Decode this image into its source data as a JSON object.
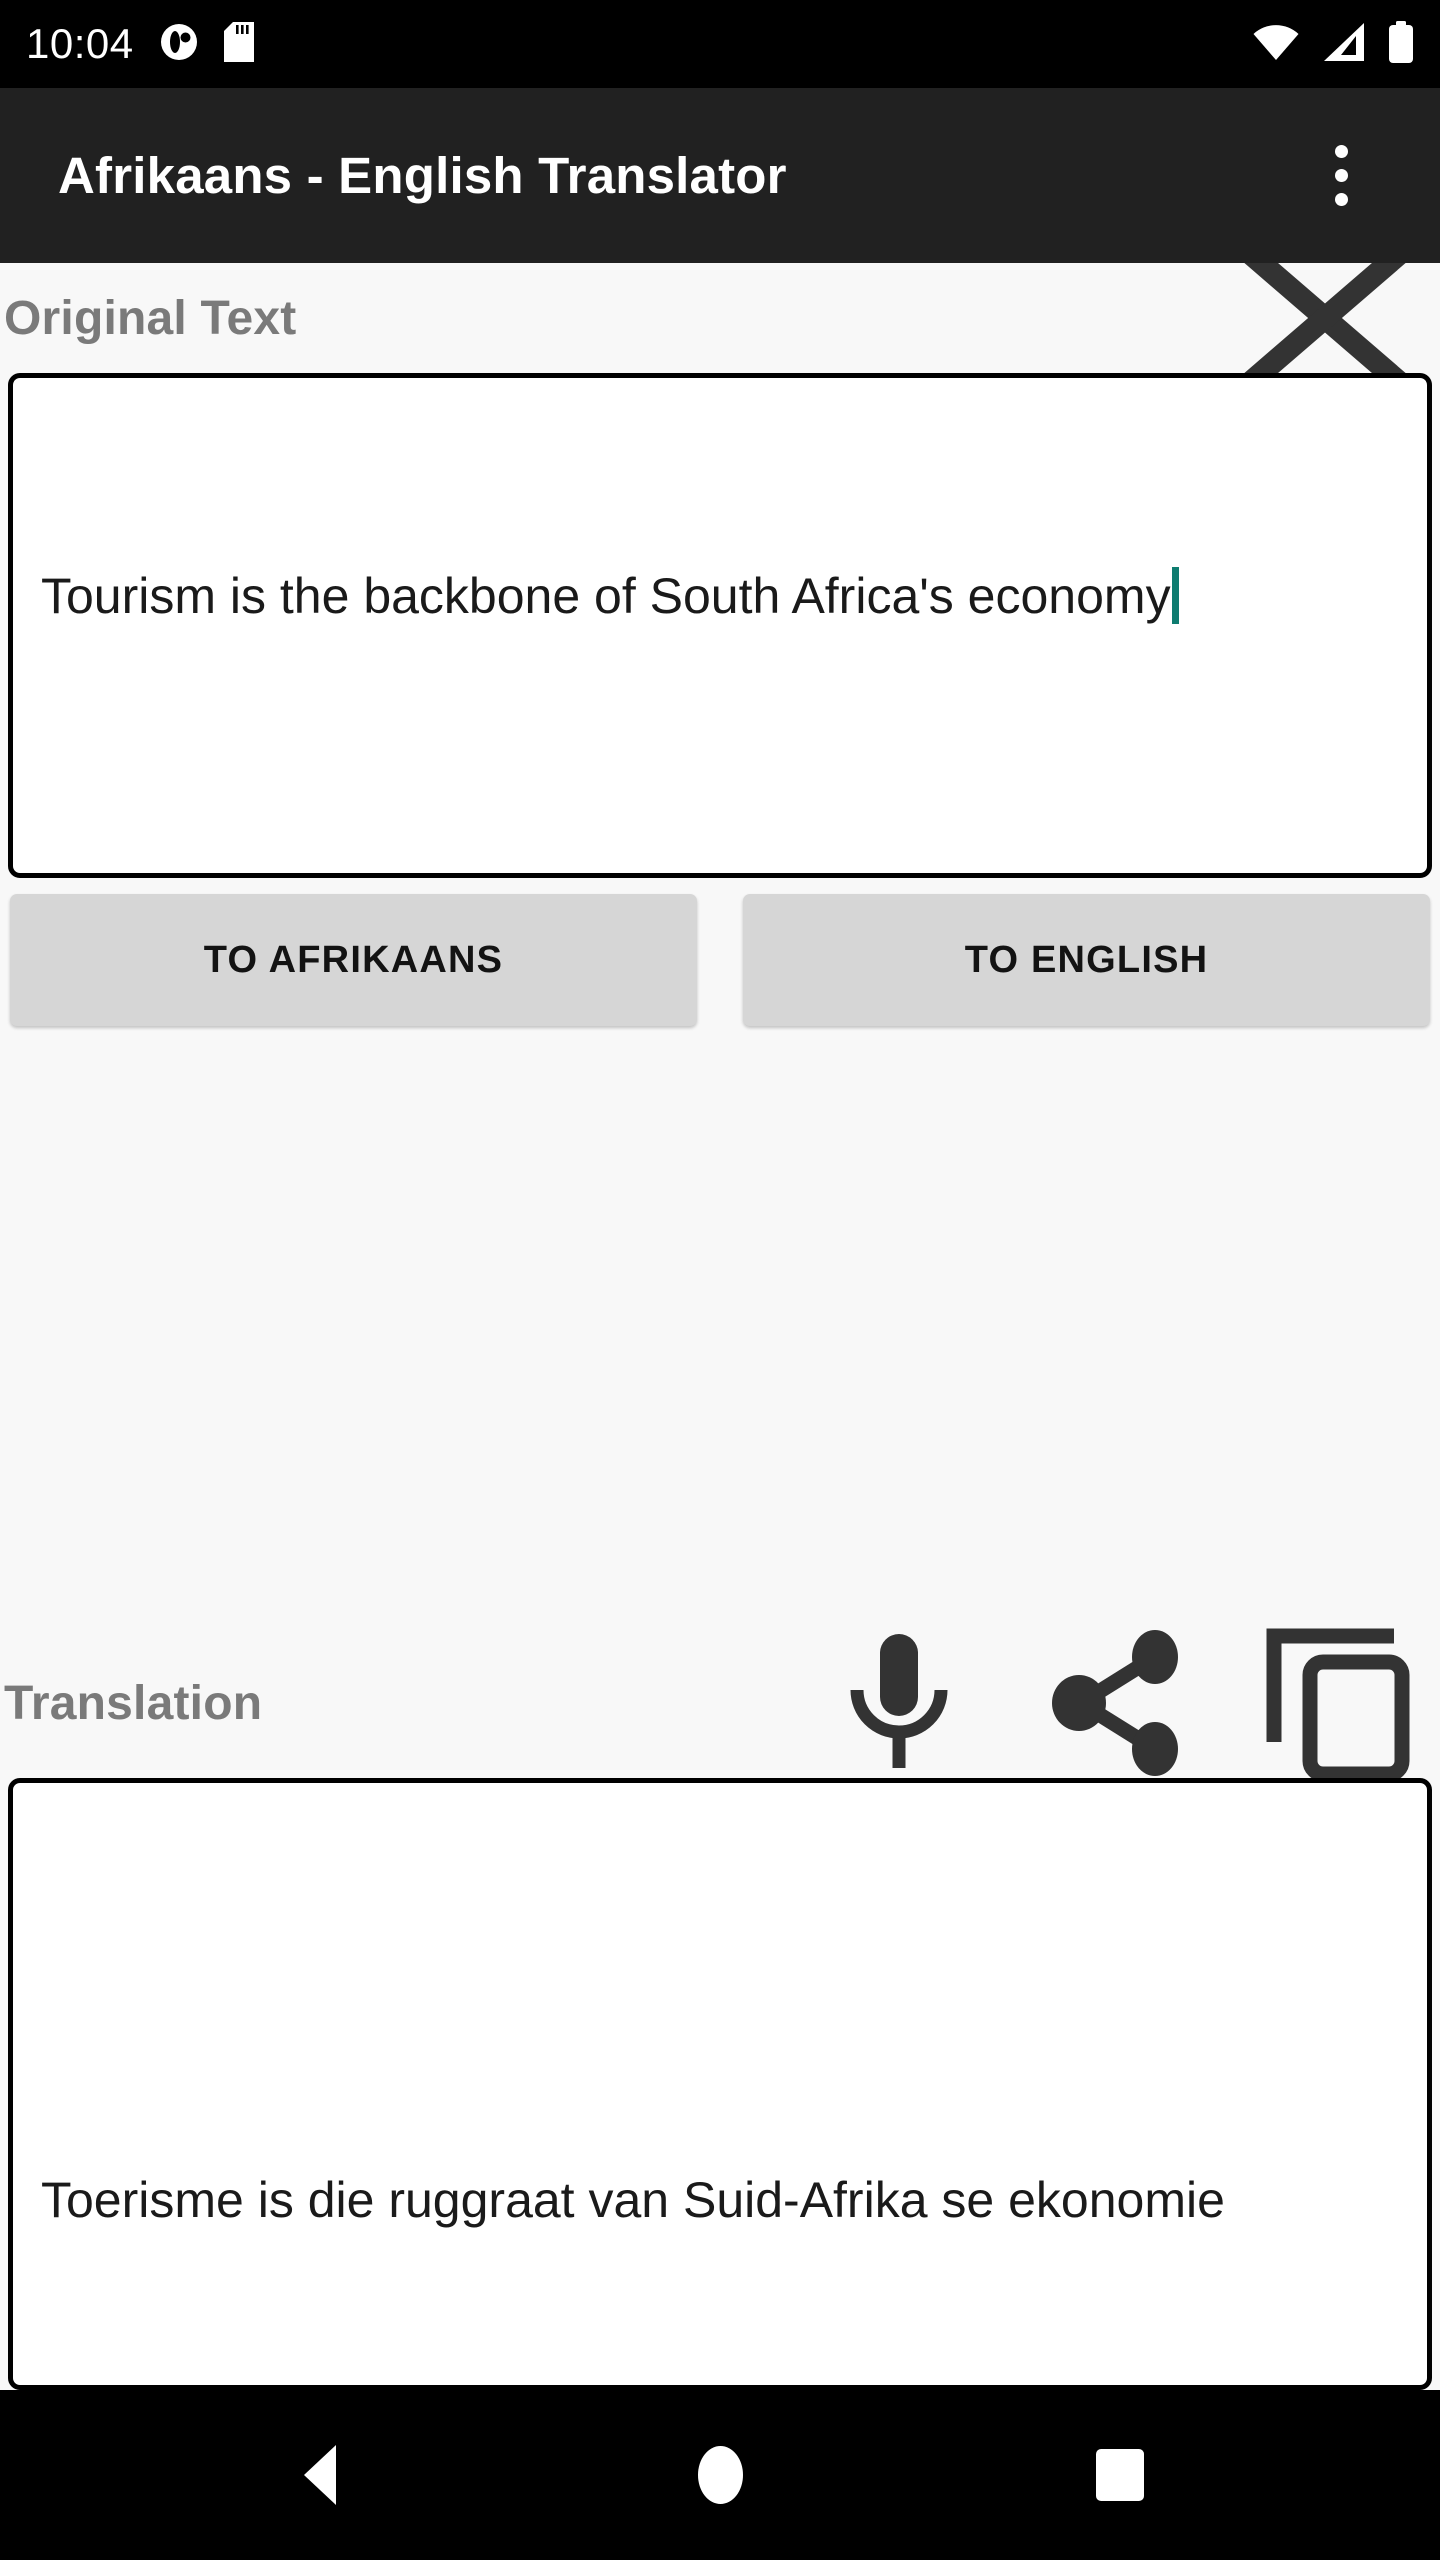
{
  "status_bar": {
    "time": "10:04",
    "left_icons": [
      "app-notification-icon",
      "sd-card-icon"
    ],
    "right_icons": [
      "wifi-icon",
      "cell-signal-icon",
      "battery-icon"
    ]
  },
  "app_bar": {
    "title": "Afrikaans - English Translator",
    "overflow_icon": "more-vertical-icon",
    "background": "#212121"
  },
  "original_section": {
    "label": "Original Text",
    "clear_icon": "close-x-icon",
    "input_value": "Tourism is the backbone of South Africa's economy",
    "input_placeholder": "",
    "caret_color": "#0e7c70"
  },
  "buttons": {
    "to_afrikaans": "TO AFRIKAANS",
    "to_english": "TO ENGLISH",
    "background": "#d6d6d6"
  },
  "translation_section": {
    "label": "Translation",
    "speak_icon": "microphone-icon",
    "share_icon": "share-icon",
    "copy_icon": "copy-icon",
    "output_value": "Toerisme is die ruggraat van Suid-Afrika se ekonomie"
  },
  "nav_bar": {
    "back": "back-triangle-icon",
    "home": "home-circle-icon",
    "recents": "recents-square-icon"
  },
  "theme": {
    "page_background": "#f8f8f8",
    "box_border": "#000000",
    "label_color": "#7a7a7a"
  }
}
